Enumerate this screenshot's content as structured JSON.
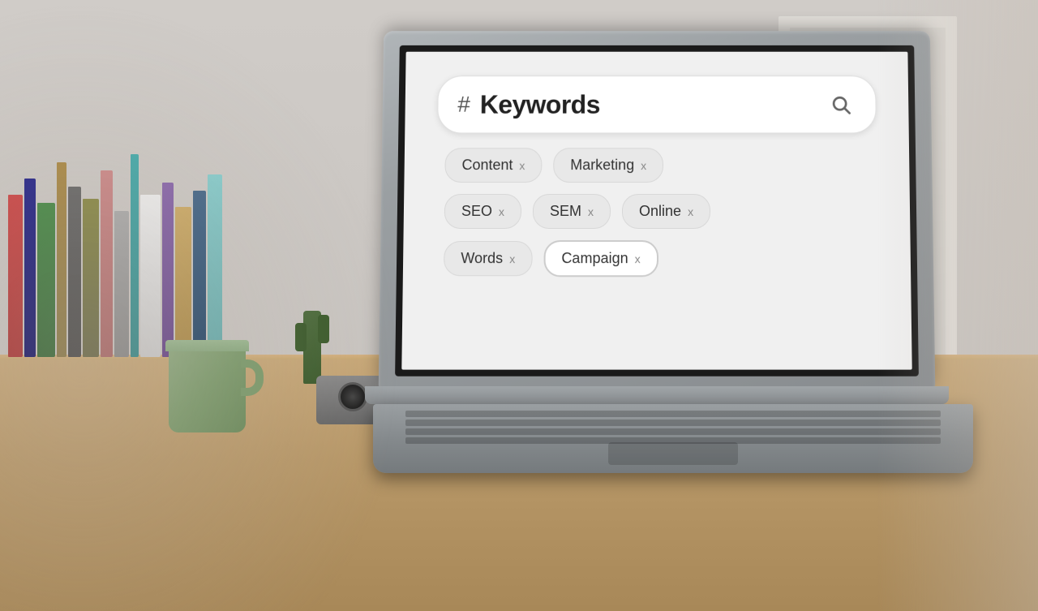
{
  "scene": {
    "search_bar": {
      "hash_symbol": "#",
      "placeholder": "Keywords",
      "search_icon": "🔍"
    },
    "tags": [
      [
        {
          "label": "Content",
          "has_x": true
        },
        {
          "label": "Marketing",
          "has_x": true
        }
      ],
      [
        {
          "label": "SEO",
          "has_x": true
        },
        {
          "label": "SEM",
          "has_x": true
        },
        {
          "label": "Online",
          "has_x": true
        }
      ],
      [
        {
          "label": "Words",
          "has_x": true
        },
        {
          "label": "Campaign",
          "has_x": true,
          "selected": true
        }
      ]
    ],
    "x_symbol": "x"
  }
}
